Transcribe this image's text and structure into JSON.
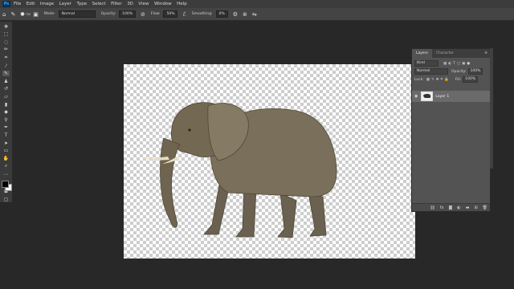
{
  "menu": {
    "logo": "Ps",
    "items": [
      "File",
      "Edit",
      "Image",
      "Layer",
      "Type",
      "Select",
      "Filter",
      "3D",
      "View",
      "Window",
      "Help"
    ]
  },
  "options": {
    "brush_size": "750",
    "mode_label": "Mode:",
    "mode_value": "Normal",
    "opacity_label": "Opacity:",
    "opacity_value": "100%",
    "flow_label": "Flow:",
    "flow_value": "50%",
    "smoothing_label": "Smoothing:",
    "smoothing_value": "0%"
  },
  "layers_panel": {
    "tabs": [
      "Layers",
      "Character"
    ],
    "kind_value": "Kind",
    "blend_value": "Normal",
    "opacity_label": "Opacity:",
    "opacity_value": "100%",
    "lock_label": "Lock:",
    "fill_label": "Fill:",
    "fill_value": "100%",
    "layer_name": "Layer 1"
  },
  "icons": {
    "brush": "brush-icon",
    "eye": "eye-icon"
  }
}
